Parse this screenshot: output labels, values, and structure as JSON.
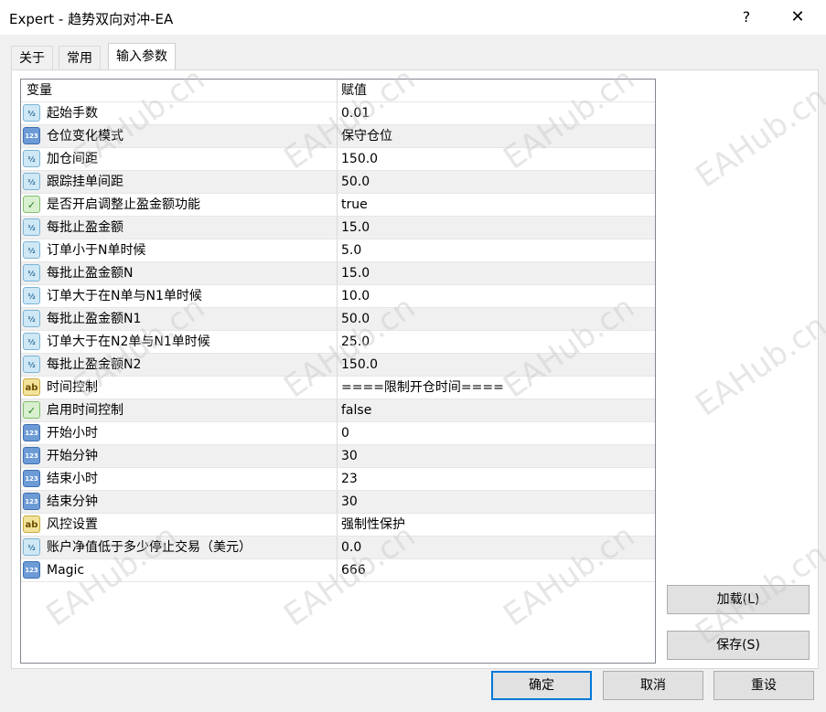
{
  "window": {
    "title": "Expert - 趋势双向对冲-EA",
    "help": "?",
    "close": "✕"
  },
  "tabs": [
    {
      "label": "关于"
    },
    {
      "label": "常用"
    },
    {
      "label": "输入参数",
      "active": true
    }
  ],
  "grid": {
    "columns": {
      "variable": "变量",
      "value": "赋值"
    },
    "rows": [
      {
        "type": "frac",
        "icon": "fraction-icon",
        "name": "起始手数",
        "value": "0.01"
      },
      {
        "type": "num",
        "icon": "integer-icon",
        "name": "仓位变化模式",
        "value": "保守仓位"
      },
      {
        "type": "frac",
        "icon": "fraction-icon",
        "name": "加仓间距",
        "value": "150.0"
      },
      {
        "type": "frac",
        "icon": "fraction-icon",
        "name": "跟踪挂单间距",
        "value": "50.0"
      },
      {
        "type": "bool",
        "icon": "boolean-icon",
        "name": "是否开启调整止盈金额功能",
        "value": "true"
      },
      {
        "type": "frac",
        "icon": "fraction-icon",
        "name": "每批止盈金额",
        "value": "15.0"
      },
      {
        "type": "frac",
        "icon": "fraction-icon",
        "name": "订单小于N单时候",
        "value": "5.0"
      },
      {
        "type": "frac",
        "icon": "fraction-icon",
        "name": "每批止盈金额N",
        "value": "15.0"
      },
      {
        "type": "frac",
        "icon": "fraction-icon",
        "name": "订单大于在N单与N1单时候",
        "value": "10.0"
      },
      {
        "type": "frac",
        "icon": "fraction-icon",
        "name": "每批止盈金额N1",
        "value": "50.0"
      },
      {
        "type": "frac",
        "icon": "fraction-icon",
        "name": "订单大于在N2单与N1单时候",
        "value": "25.0"
      },
      {
        "type": "frac",
        "icon": "fraction-icon",
        "name": "每批止盈金额N2",
        "value": "150.0"
      },
      {
        "type": "str",
        "icon": "string-icon",
        "name": "时间控制",
        "value": "====限制开仓时间===="
      },
      {
        "type": "bool",
        "icon": "boolean-icon",
        "name": "启用时间控制",
        "value": "false"
      },
      {
        "type": "num",
        "icon": "integer-icon",
        "name": "开始小时",
        "value": "0"
      },
      {
        "type": "num",
        "icon": "integer-icon",
        "name": "开始分钟",
        "value": "30"
      },
      {
        "type": "num",
        "icon": "integer-icon",
        "name": "结束小时",
        "value": "23"
      },
      {
        "type": "num",
        "icon": "integer-icon",
        "name": "结束分钟",
        "value": "30"
      },
      {
        "type": "str",
        "icon": "string-icon",
        "name": "风控设置",
        "value": "强制性保护"
      },
      {
        "type": "frac",
        "icon": "fraction-icon",
        "name": "账户净值低于多少停止交易（美元）",
        "value": "0.0"
      },
      {
        "type": "num",
        "icon": "integer-icon",
        "name": "Magic",
        "value": "666"
      }
    ]
  },
  "icon_glyphs": {
    "frac": "½",
    "num": "123",
    "bool": "✓",
    "str": "ab"
  },
  "buttons": {
    "load": "加载(L)",
    "save": "保存(S)",
    "ok": "确定",
    "cancel": "取消",
    "reset": "重设"
  },
  "watermark": "EAHub.cn",
  "colors": {
    "default_button_border": "#0078d7",
    "alt_row": "#f0f0f0"
  }
}
